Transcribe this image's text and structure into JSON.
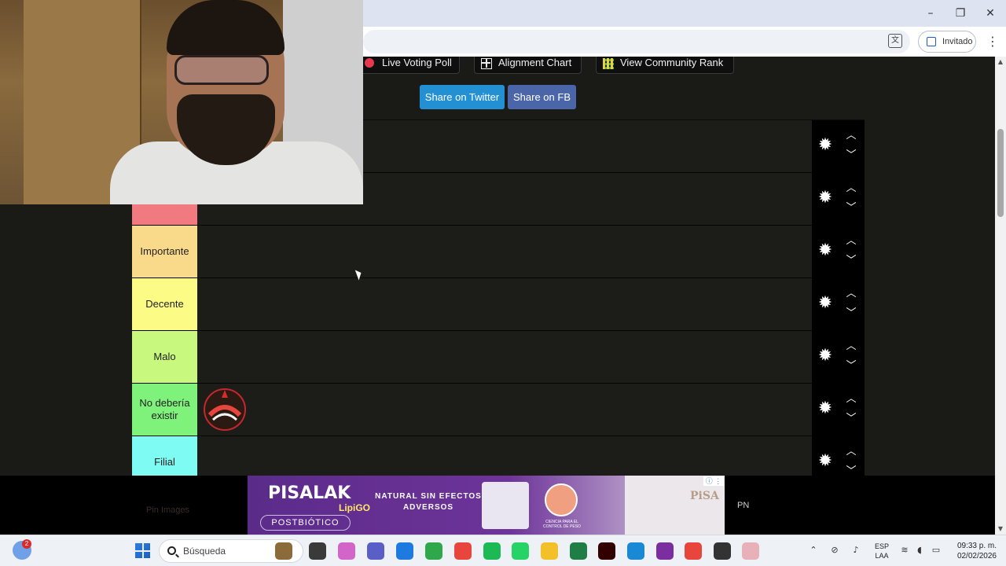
{
  "browser": {
    "profile_label": "Invitado",
    "minimize_glyph": "–",
    "restore_glyph": "❐",
    "close_glyph": "✕",
    "menu_glyph": "⋮",
    "translate_glyph": "文"
  },
  "page": {
    "top_buttons": [
      {
        "label": "Live Voting Poll",
        "icon": "red-dot-icon"
      },
      {
        "label": "Alignment Chart",
        "icon": "grid-icon"
      },
      {
        "label": "View Community Rank",
        "icon": "rank-grid-icon"
      }
    ],
    "share_twitter": "Share on Twitter",
    "share_fb": "Share on FB",
    "tiers": [
      {
        "label": "",
        "color": "#f07a80"
      },
      {
        "label": "Importante",
        "color": "#f9d98a"
      },
      {
        "label": "Decente",
        "color": "#fbfb86"
      },
      {
        "label": "Malo",
        "color": "#c8f87e"
      },
      {
        "label": "No debería existir",
        "color": "#7ef27a"
      },
      {
        "label": "Filial",
        "color": "#7efbf2"
      }
    ],
    "tier_item_logo": "Alebrijes Oaxaca",
    "pin_text": "Pin Images",
    "pn_text": "PN",
    "gear_glyph": "✹",
    "up_glyph": "︿",
    "down_glyph": "﹀"
  },
  "ad": {
    "brand": "PISALAK",
    "sub": "LipiGO",
    "tag": "POSTBIÓTICO",
    "claim": "NATURAL SIN EFECTOS ADVERSOS",
    "circle_caption": "CIENCIA PARA EL CONTROL DE PESO",
    "logo": "PiSA",
    "info": "ⓘ ⋮"
  },
  "taskbar": {
    "badge": "2",
    "search_placeholder": "Búsqueda",
    "lang_line1": "ESP",
    "lang_line2": "LAA",
    "time": "09:33 p. m.",
    "date": "02/02/2026",
    "apps": [
      {
        "name": "widgets-app",
        "color": "#8c6b3a"
      },
      {
        "name": "file-explorer-dark-app",
        "color": "#3a3a3a"
      },
      {
        "name": "copilot-app",
        "color": "#d266c8"
      },
      {
        "name": "teams-app",
        "color": "#5a5fc7"
      },
      {
        "name": "store-app",
        "color": "#1f7ae0"
      },
      {
        "name": "money-app",
        "color": "#2ea84a"
      },
      {
        "name": "chrome-app",
        "color": "#e8453c"
      },
      {
        "name": "spotify-app",
        "color": "#1db954"
      },
      {
        "name": "whatsapp-app",
        "color": "#25d366"
      },
      {
        "name": "folder-app",
        "color": "#f2c029"
      },
      {
        "name": "excel-app",
        "color": "#1e7e45"
      },
      {
        "name": "illustrator-app",
        "color": "#330000"
      },
      {
        "name": "edge-app",
        "color": "#1989d6"
      },
      {
        "name": "photos-app",
        "color": "#7b2ea0"
      },
      {
        "name": "chrome-active-app",
        "color": "#e8453c"
      },
      {
        "name": "settings-app",
        "color": "#333333"
      },
      {
        "name": "notion-app",
        "color": "#e8b0b8"
      }
    ]
  }
}
